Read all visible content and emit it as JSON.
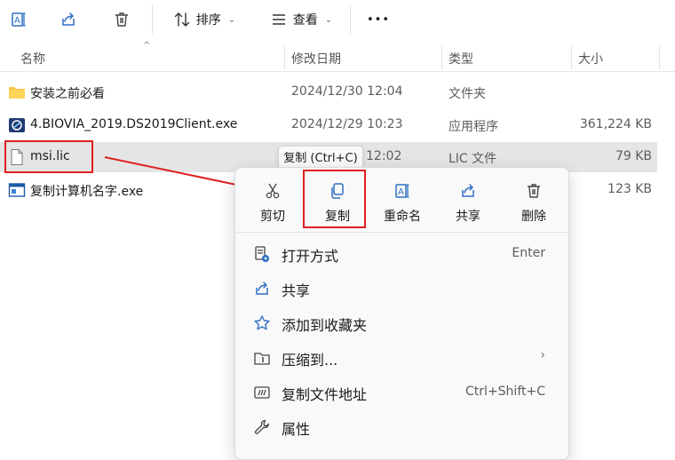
{
  "toolbar": {
    "sort_label": "排序",
    "view_label": "查看",
    "more_label": "•••"
  },
  "columns": {
    "name": "名称",
    "modified": "修改日期",
    "type": "类型",
    "size": "大小"
  },
  "files": [
    {
      "name": "安装之前必看",
      "modified": "2024/12/30 12:04",
      "type": "文件夹",
      "size": "",
      "icon": "folder-icon"
    },
    {
      "name": "4.BIOVIA_2019.DS2019Client.exe",
      "modified": "2024/12/29 10:23",
      "type": "应用程序",
      "size": "361,224 KB",
      "icon": "exe-app-icon"
    },
    {
      "name": "msi.lic",
      "modified": "12:02",
      "type": "LIC 文件",
      "size": "79 KB",
      "icon": "file-icon"
    },
    {
      "name": "复制计算机名字.exe",
      "modified": "",
      "type": "",
      "size": "123 KB",
      "icon": "exe-window-icon"
    }
  ],
  "tooltip": "复制 (Ctrl+C)",
  "context_menu": {
    "quick_actions": [
      {
        "label": "剪切",
        "icon": "cut-icon"
      },
      {
        "label": "复制",
        "icon": "copy-icon"
      },
      {
        "label": "重命名",
        "icon": "rename-icon"
      },
      {
        "label": "共享",
        "icon": "share-icon"
      },
      {
        "label": "删除",
        "icon": "delete-icon"
      }
    ],
    "items": [
      {
        "label": "打开方式",
        "shortcut": "Enter",
        "icon": "open-with-icon"
      },
      {
        "label": "共享",
        "shortcut": "",
        "icon": "share-icon"
      },
      {
        "label": "添加到收藏夹",
        "shortcut": "",
        "icon": "star-icon"
      },
      {
        "label": "压缩到...",
        "shortcut": "",
        "submenu_arrow": "›",
        "icon": "compress-icon"
      },
      {
        "label": "复制文件地址",
        "shortcut": "Ctrl+Shift+C",
        "icon": "copy-path-icon"
      },
      {
        "label": "属性",
        "shortcut": "",
        "icon": "wrench-icon"
      }
    ]
  },
  "colors": {
    "accent": "#0067c0",
    "annotation_red": "#e02020",
    "selected_row": "#e5e5e5",
    "folder": "#f5c342"
  }
}
